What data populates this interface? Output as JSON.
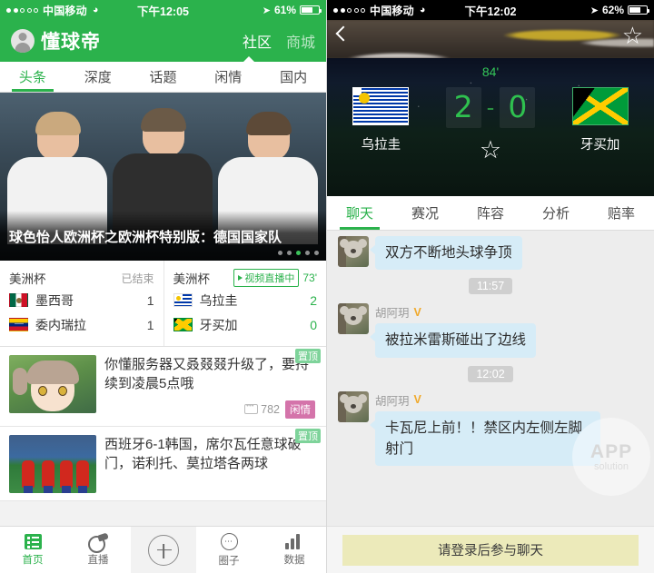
{
  "left": {
    "status_bar": {
      "signal_filled": 2,
      "signal_total": 5,
      "carrier": "中国移动",
      "wifi_icon": "wifi-icon",
      "time": "下午12:05",
      "location_icon": "location-arrow-icon",
      "battery": "61%",
      "battery_level_pct": 61
    },
    "navbar": {
      "avatar_icon": "user-avatar-icon",
      "brand": "懂球帝",
      "links": [
        {
          "label": "社区",
          "active": true
        },
        {
          "label": "商城",
          "active": false
        }
      ]
    },
    "tabs": [
      {
        "label": "头条",
        "active": true
      },
      {
        "label": "深度",
        "active": false
      },
      {
        "label": "话题",
        "active": false
      },
      {
        "label": "闲情",
        "active": false
      },
      {
        "label": "国内",
        "active": false
      }
    ],
    "hero": {
      "title": "球色怡人欧洲杯之欧洲杯特别版：德国国家队",
      "dots_total": 5,
      "dots_active_index": 2
    },
    "match_cards": [
      {
        "league": "美洲杯",
        "status": "已结束",
        "is_live": false,
        "teams": [
          {
            "name": "墨西哥",
            "score": "1",
            "flag": "mexico-flag-icon"
          },
          {
            "name": "委内瑞拉",
            "score": "1",
            "flag": "venezuela-flag-icon"
          }
        ]
      },
      {
        "league": "美洲杯",
        "live_label": "视频直播中",
        "minute": "73'",
        "is_live": true,
        "teams": [
          {
            "name": "乌拉圭",
            "score": "2",
            "flag": "uruguay-flag-icon"
          },
          {
            "name": "牙买加",
            "score": "0",
            "flag": "jamaica-flag-icon"
          }
        ]
      }
    ],
    "news": [
      {
        "pin_label": "置顶",
        "title": "你懂服务器又叒叕叕升级了，要持续到凌晨5点哦",
        "comments": "782",
        "tag": "闲情",
        "thumb": "anime-character-thumb"
      },
      {
        "pin_label": "置顶",
        "title": "西班牙6-1韩国，席尔瓦任意球破门，诺利托、莫拉塔各两球",
        "comments": "",
        "tag": "",
        "thumb": "football-players-thumb"
      }
    ],
    "bottom_nav": [
      {
        "label": "首页",
        "icon": "list-icon",
        "active": true
      },
      {
        "label": "直播",
        "icon": "whistle-icon",
        "active": false
      },
      {
        "label": "",
        "icon": "plus-circle-icon",
        "active": false
      },
      {
        "label": "圈子",
        "icon": "ellipsis-circle-icon",
        "active": false
      },
      {
        "label": "数据",
        "icon": "bar-chart-icon",
        "active": false
      }
    ]
  },
  "right": {
    "status_bar": {
      "signal_filled": 2,
      "signal_total": 5,
      "carrier": "中国移动",
      "wifi_icon": "wifi-icon",
      "time": "下午12:02",
      "location_icon": "location-arrow-icon",
      "battery": "62%",
      "battery_level_pct": 62
    },
    "match_header": {
      "back_icon": "back-chevron-icon",
      "favorite_icon": "star-outline-icon",
      "minute": "84'",
      "home": {
        "name": "乌拉圭",
        "score": "2",
        "flag": "uruguay-flag-icon"
      },
      "away": {
        "name": "牙买加",
        "score": "0",
        "flag": "jamaica-flag-icon"
      },
      "score_separator": "-",
      "center_favorite_icon": "star-outline-icon"
    },
    "tabs": [
      {
        "label": "聊天",
        "active": true
      },
      {
        "label": "赛况",
        "active": false
      },
      {
        "label": "阵容",
        "active": false
      },
      {
        "label": "分析",
        "active": false
      },
      {
        "label": "赔率",
        "active": false
      }
    ],
    "chat": [
      {
        "kind": "message",
        "author": "",
        "verified": false,
        "text": "双方不断地头球争顶",
        "avatar": "koala-avatar"
      },
      {
        "kind": "time",
        "text": "11:57"
      },
      {
        "kind": "message",
        "author": "胡阿玥",
        "verified": true,
        "verified_mark": "V",
        "text": "被拉米雷斯碰出了边线",
        "avatar": "koala-avatar"
      },
      {
        "kind": "time",
        "text": "12:02"
      },
      {
        "kind": "message",
        "author": "胡阿玥",
        "verified": true,
        "verified_mark": "V",
        "text": "卡瓦尼上前！！禁区内左侧左脚射门",
        "avatar": "koala-avatar"
      }
    ],
    "watermark": {
      "line1": "APP",
      "line2": "solution"
    },
    "login_bar": {
      "label": "请登录后参与聊天"
    }
  },
  "colors": {
    "brand_green": "#2bb24c",
    "score_green": "#2fc14f",
    "bubble_blue": "#d6ecf7",
    "login_yellow": "#eceaba",
    "tag_pink": "#d474aa",
    "pin_green": "#7ed39a",
    "verified_orange": "#f0a92b"
  }
}
